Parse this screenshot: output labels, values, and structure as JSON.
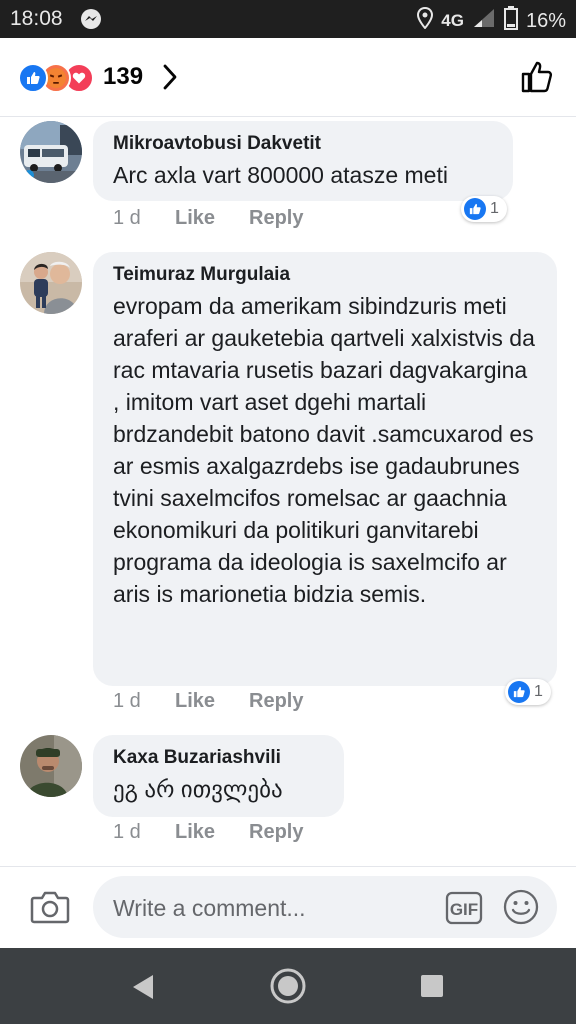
{
  "status_bar": {
    "time": "18:08",
    "network": "4G",
    "battery": "16%"
  },
  "header": {
    "reaction_count": "139"
  },
  "comments": [
    {
      "author": "Mikroavtobusi Dakvetit",
      "text": "Arc axla vart 800000 atasze meti",
      "age": "1 d",
      "like_label": "Like",
      "reply_label": "Reply",
      "like_count": "1"
    },
    {
      "author": "Teimuraz Murgulaia",
      "text": "evropam da amerikam sibindzuris meti araferi ar gauketebia qartveli xalxistvis da rac mtavaria rusetis bazari dagvakargina , imitom vart aset dgehi martali brdzandebit batono davit .samcuxarod es ar esmis axalgazrdebs ise gadaubrunes tvini saxelmcifos romelsac ar gaachnia ekonomikuri da politikuri ganvitarebi programa da ideologia is saxelmcifo ar aris is marionetia bidzia semis.",
      "age": "1 d",
      "like_label": "Like",
      "reply_label": "Reply",
      "like_count": "1"
    },
    {
      "author": "Kaxa Buzariashvili",
      "text": "ეგ არ ითვლება",
      "age": "1 d",
      "like_label": "Like",
      "reply_label": "Reply"
    }
  ],
  "composer": {
    "placeholder": "Write a comment...",
    "gif_label": "GIF"
  },
  "colors": {
    "accent_blue": "#1877f2",
    "bubble_bg": "#f0f2f5",
    "status_bar": "#1f1f1f",
    "nav_bar": "#3c4043"
  }
}
